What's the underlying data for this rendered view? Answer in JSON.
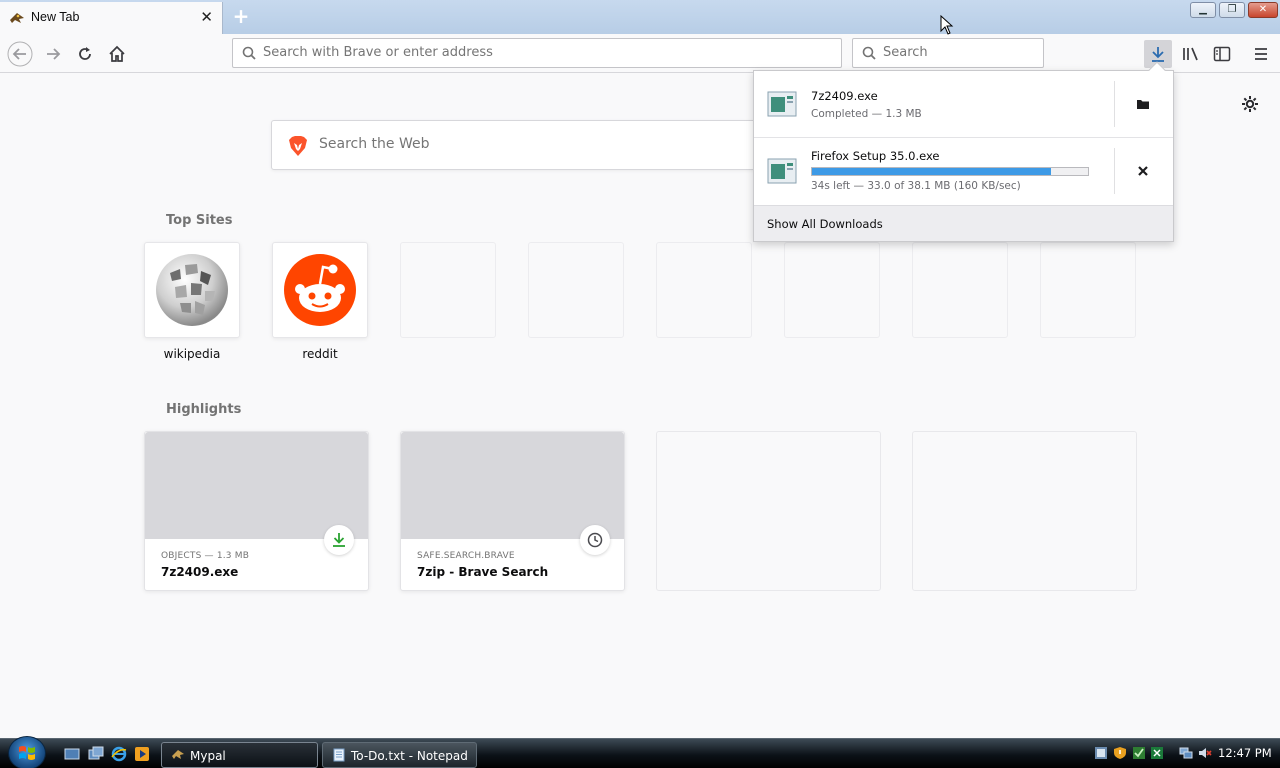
{
  "tab": {
    "title": "New Tab",
    "close_icon": "close-icon"
  },
  "toolbar": {
    "url_placeholder": "Search with Brave or enter address",
    "search_placeholder": "Search"
  },
  "content": {
    "web_search_placeholder": "Search the Web",
    "top_sites_title": "Top Sites",
    "top_sites": [
      {
        "label": "wikipedia",
        "icon": "wikipedia-globe-icon"
      },
      {
        "label": "reddit",
        "icon": "reddit-icon"
      }
    ],
    "highlights_title": "Highlights",
    "highlights": [
      {
        "context": "OBJECTS — 1.3 MB",
        "name": "7z2409.exe",
        "badge_icon": "download-icon"
      },
      {
        "context": "SAFE.SEARCH.BRAVE",
        "name": "7zip - Brave Search",
        "badge_icon": "clock-icon"
      }
    ]
  },
  "downloads": {
    "items": [
      {
        "name": "7z2409.exe",
        "status": "Completed — 1.3 MB",
        "action_icon": "folder-icon"
      },
      {
        "name": "Firefox Setup 35.0.exe",
        "status": "34s left — 33.0 of 38.1 MB (160 KB/sec)",
        "progress": 0.866,
        "action_icon": "cancel-icon"
      }
    ],
    "footer": "Show All Downloads"
  },
  "taskbar": {
    "buttons": [
      {
        "label": "Mypal"
      },
      {
        "label": "To-Do.txt - Notepad"
      }
    ],
    "clock": "12:47 PM"
  },
  "colors": {
    "progress": "#3d9ae6",
    "reddit": "#ff4500",
    "download_green": "#2aa332"
  }
}
